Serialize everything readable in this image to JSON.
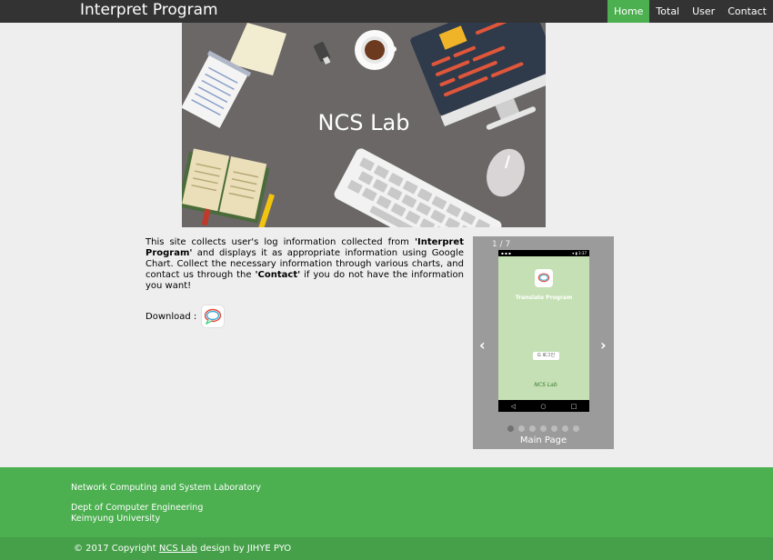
{
  "nav": {
    "brand": "Interpret Program",
    "links": [
      "Home",
      "Total",
      "User",
      "Contact"
    ],
    "active_index": 0
  },
  "hero": {
    "title": "NCS Lab"
  },
  "description": {
    "part1": "This site collects user's log information collected from ",
    "bold1": "'Interpret Program'",
    "part2": " and displays it as appropriate information using Google Chart. Collect the necessary information through various charts, and contact us through the ",
    "bold2": "'Contact'",
    "part3": " if you do not have the information you want!"
  },
  "download": {
    "label": "Download :",
    "icon": "chat-bubble-icon"
  },
  "slideshow": {
    "counter": "1 / 7",
    "prev_label": "‹",
    "next_label": "›",
    "caption": "Main Page",
    "total_slides": 7,
    "current_slide": 1,
    "screen": {
      "status_left": "▪ ▪ ▪",
      "status_right": "▾ ▮ 3:37",
      "app_title": "Translate Program",
      "google_button": "G 로그인",
      "logo_text": "NCS Lab",
      "nav_back": "◁",
      "nav_home": "○",
      "nav_recent": "□"
    }
  },
  "footer": {
    "lab": "Network Computing and System Laboratory",
    "dept": "Dept of Computer Engineering",
    "university": "Keimyung University",
    "copyright_prefix": "© 2017 Copyright ",
    "copyright_link": "NCS Lab",
    "copyright_suffix": " design by JIHYE PYO"
  },
  "colors": {
    "nav_bg": "#333333",
    "accent": "#4CAF50",
    "page_bg": "#eeeeee",
    "slideshow_bg": "#9b9b9b"
  }
}
